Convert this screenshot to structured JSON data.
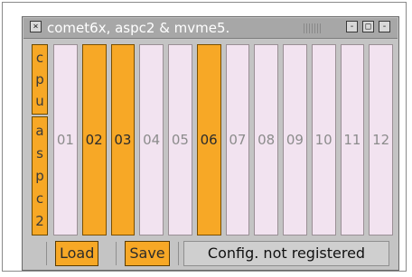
{
  "window": {
    "title": "comet6x, aspc2 & mvme5.",
    "title_buttons": {
      "close_icon": "close-icon",
      "minimize_icon": "minimize-icon",
      "maximize_icon": "maximize-icon",
      "close_right_icon": "close-icon"
    }
  },
  "left_column": {
    "cpu_letters": [
      "c",
      "p",
      "u"
    ],
    "aspc2_letters": [
      "a",
      "s",
      "p",
      "c",
      "2"
    ]
  },
  "slots": [
    {
      "label": "01",
      "active": false
    },
    {
      "label": "02",
      "active": true
    },
    {
      "label": "03",
      "active": true
    },
    {
      "label": "04",
      "active": false
    },
    {
      "label": "05",
      "active": false
    },
    {
      "label": "06",
      "active": true
    },
    {
      "label": "07",
      "active": false
    },
    {
      "label": "08",
      "active": false
    },
    {
      "label": "09",
      "active": false
    },
    {
      "label": "10",
      "active": false
    },
    {
      "label": "11",
      "active": false
    },
    {
      "label": "12",
      "active": false
    }
  ],
  "bottom": {
    "load_label": "Load",
    "save_label": "Save",
    "status_text": "Config. not registered"
  },
  "colors": {
    "active": "#f7a826",
    "inactive": "#f2e3f0"
  }
}
